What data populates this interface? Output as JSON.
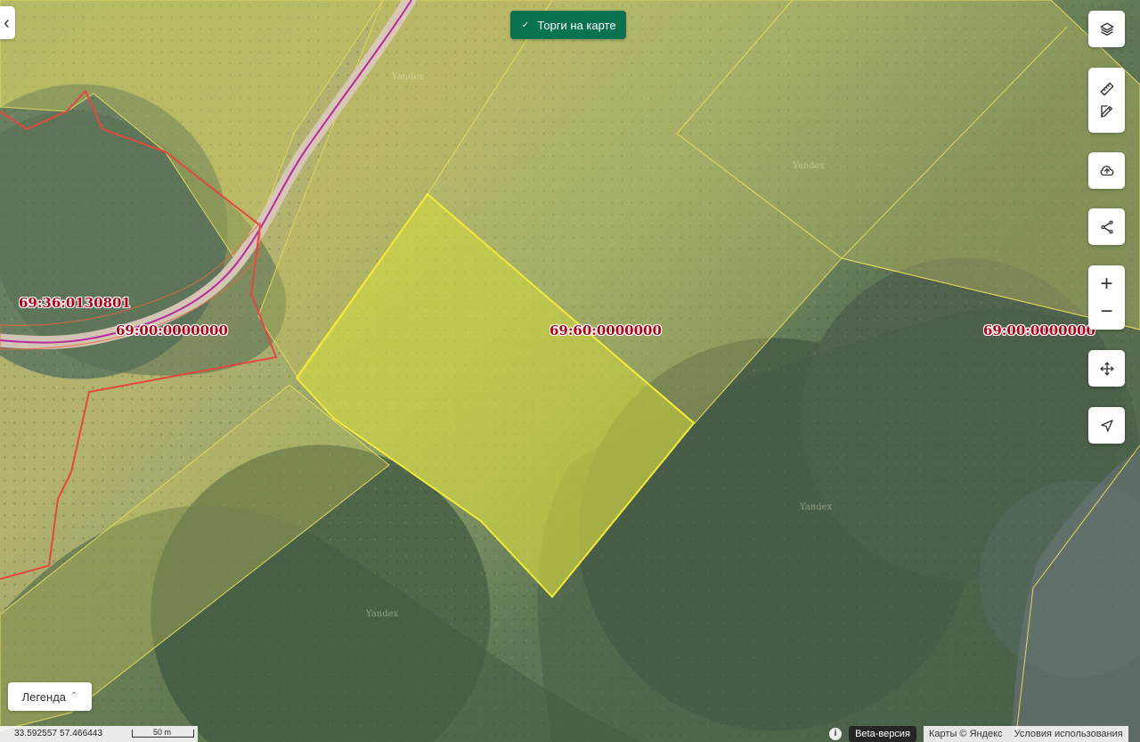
{
  "map": {
    "watermarks": [
      "Yandex",
      "Yandex",
      "Yandex",
      "Yandex"
    ],
    "cadastral_labels": [
      "69:36:0130801",
      "69:00:0000000",
      "69:60:0000000",
      "69:00:0000000"
    ],
    "colors": {
      "selected_parcel": "#d6da42",
      "parcel_fill": "#c6c65a",
      "parcel_border": "#e0d75e",
      "red_boundary": "#e3473f",
      "road": "#b72aa0"
    }
  },
  "top_badge": {
    "label": "Торги на карте",
    "icon": "checkmark-icon"
  },
  "controls": {
    "back_icon": "chevron-left-icon",
    "layers_icon": "layers-icon",
    "ruler_icon": "ruler-icon",
    "edit_icon": "edit-icon",
    "upload_icon": "cloud-upload-icon",
    "share_icon": "share-icon",
    "zoom_in_label": "+",
    "zoom_out_label": "−",
    "move_icon": "move-icon",
    "location_icon": "location-arrow-icon"
  },
  "legend": {
    "label": "Легенда",
    "chevron": "⌃"
  },
  "footer": {
    "coordinates": "33.592557  57.466443",
    "scale": "50 m",
    "info_symbol": "i",
    "beta_label": "Beta-версия",
    "copyright": "Карты © Яндекс",
    "terms": "Условия использования"
  }
}
